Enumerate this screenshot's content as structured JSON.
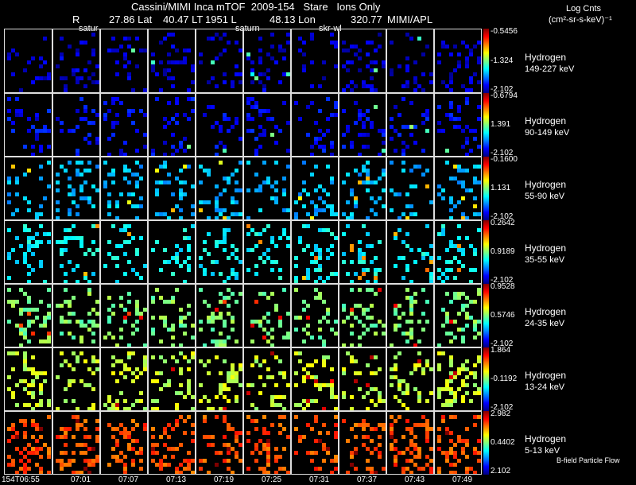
{
  "header": {
    "line1": "Cassini/MIMI Inca mTOF  2009-154   Stare   Ions Only",
    "r_label": "R",
    "lat_label": "27.86 Lat",
    "lt_label": "40.47 LT",
    "l_label": "1951 L",
    "lon_label": "48.13 Lon",
    "val5": "320.77",
    "apl": "MIMI/APL",
    "units_title": "Log Cnts",
    "units": "(cm²-sr-s-keV)⁻¹"
  },
  "overlay_labels": [
    "satur",
    "saturn",
    "skr-wl"
  ],
  "timestamps": [
    "154T06:55",
    "07:01",
    "07:07",
    "07:13",
    "07:19",
    "07:25",
    "07:31",
    "07:37",
    "07:43",
    "07:49"
  ],
  "rows": [
    {
      "species": "Hydrogen",
      "energy": "149-227 keV",
      "max": "-0.5456",
      "mid": "-1.324",
      "min": "-2.102",
      "level": 0.08
    },
    {
      "species": "Hydrogen",
      "energy": "90-149 keV",
      "max": "-0.6794",
      "mid": "1.391",
      "min": "-2.102",
      "level": 0.12
    },
    {
      "species": "Hydrogen",
      "energy": "55-90 keV",
      "max": "-0.1600",
      "mid": "1.131",
      "min": "-2.102",
      "level": 0.3
    },
    {
      "species": "Hydrogen",
      "energy": "35-55 keV",
      "max": "0.2642",
      "mid": "0.9189",
      "min": "-2.102",
      "level": 0.37
    },
    {
      "species": "Hydrogen",
      "energy": "24-35 keV",
      "max": "0.9528",
      "mid": "0.5746",
      "min": "-2.102",
      "level": 0.5
    },
    {
      "species": "Hydrogen",
      "energy": "13-24 keV",
      "max": "1.864",
      "mid": "-0.1192",
      "min": "-2.102",
      "level": 0.57
    },
    {
      "species": "Hydrogen",
      "energy": "5-13 keV",
      "max": "2.982",
      "mid": "0.4402",
      "min": "2.102",
      "level": 0.8
    }
  ],
  "footer_label": "B-field Particle Flow",
  "chart_data": {
    "type": "heatmap",
    "title": "Cassini/MIMI Inca mTOF  2009-154   Stare   Ions Only",
    "colorbar_label": "Log Cnts (cm²-sr-s-keV)⁻¹",
    "columns": [
      "154T06:55",
      "07:01",
      "07:07",
      "07:13",
      "07:19",
      "07:25",
      "07:31",
      "07:37",
      "07:43",
      "07:49"
    ],
    "rows": [
      "Hydrogen 149-227 keV",
      "Hydrogen 90-149 keV",
      "Hydrogen 55-90 keV",
      "Hydrogen 35-55 keV",
      "Hydrogen 24-35 keV",
      "Hydrogen 13-24 keV",
      "Hydrogen 5-13 keV"
    ],
    "colorbar_ranges": [
      [
        -2.102,
        -1.324,
        -0.5456
      ],
      [
        -2.102,
        1.391,
        -0.6794
      ],
      [
        -2.102,
        1.131,
        -0.16
      ],
      [
        -2.102,
        0.9189,
        0.2642
      ],
      [
        -2.102,
        0.5746,
        0.9528
      ],
      [
        -2.102,
        -0.1192,
        1.864
      ],
      [
        2.102,
        0.4402,
        2.982
      ]
    ]
  }
}
